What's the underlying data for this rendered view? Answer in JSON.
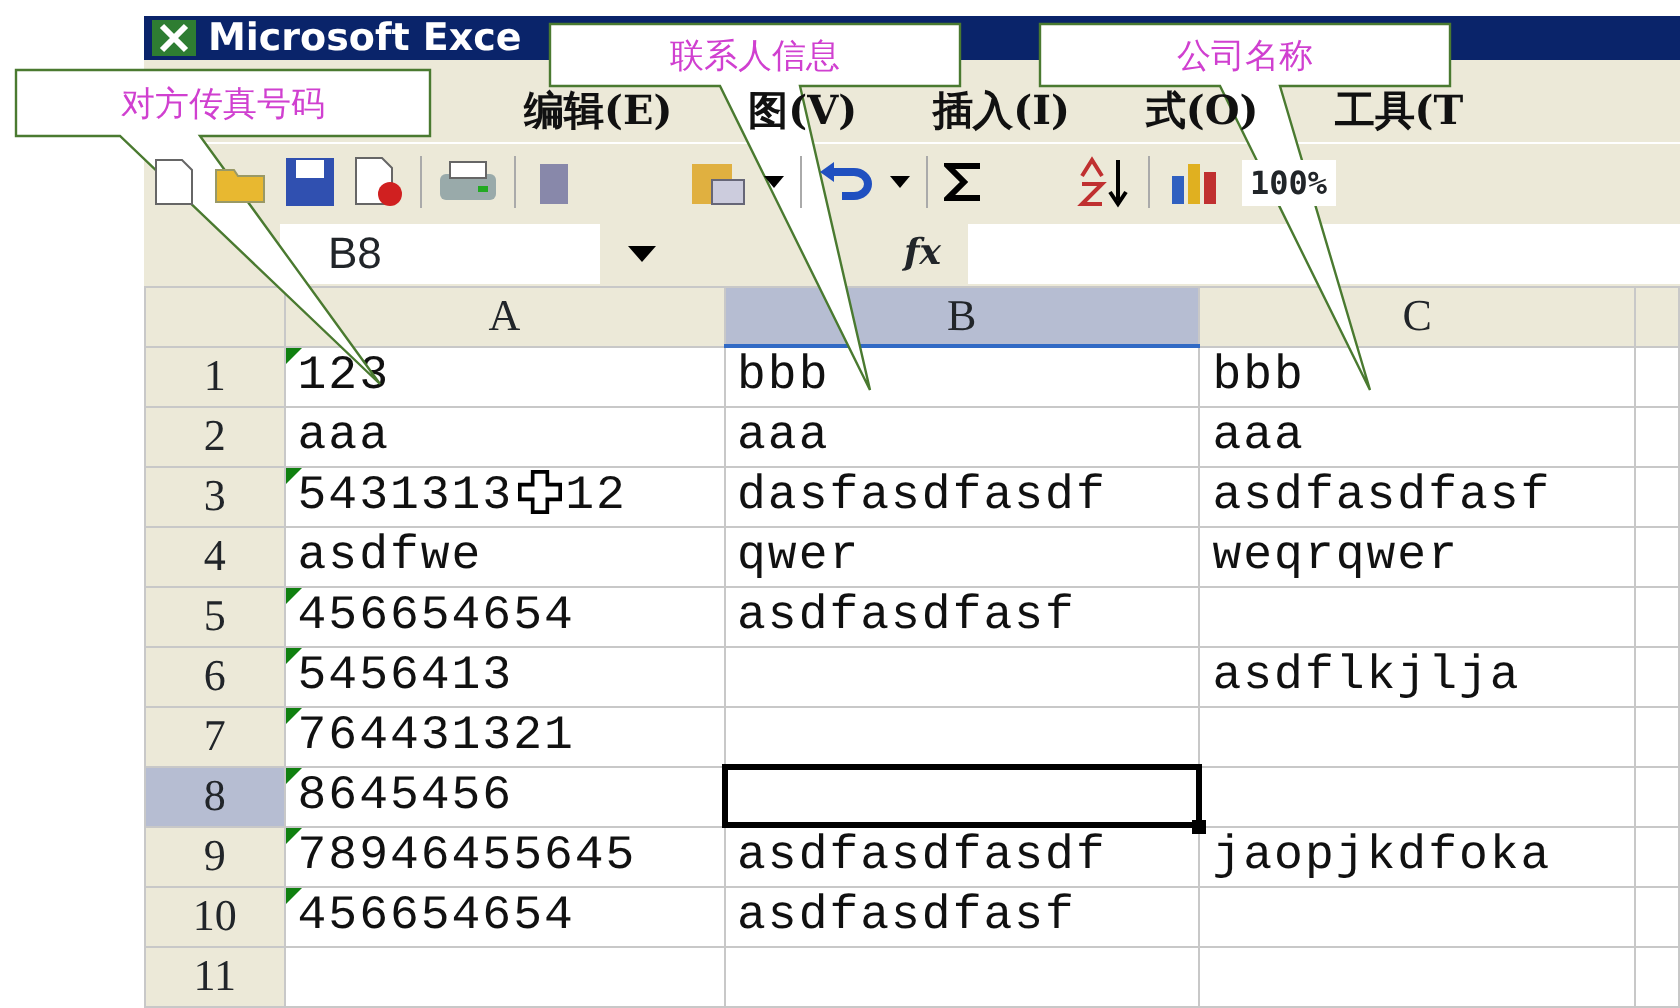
{
  "window": {
    "title": "Microsoft Exce"
  },
  "menu": [
    {
      "label": "编辑(E)"
    },
    {
      "label": "图(V)"
    },
    {
      "label": "插入(I)"
    },
    {
      "label": "式(O)"
    },
    {
      "label": "工具(T"
    }
  ],
  "toolbar": {
    "zoom": "100%"
  },
  "formula_bar": {
    "name_box": "B8",
    "fx": "fx"
  },
  "columns": [
    {
      "label": "A",
      "selected": false
    },
    {
      "label": "B",
      "selected": true
    },
    {
      "label": "C",
      "selected": false
    }
  ],
  "rows": [
    {
      "number": "1",
      "selected": false,
      "cells": [
        {
          "text": "123",
          "flag": true
        },
        {
          "text": "bbb"
        },
        {
          "text": "bbb"
        }
      ]
    },
    {
      "number": "2",
      "selected": false,
      "cells": [
        {
          "text": "aaa"
        },
        {
          "text": "aaa"
        },
        {
          "text": "aaa"
        }
      ]
    },
    {
      "number": "3",
      "selected": false,
      "cells": [
        {
          "text": "5431313",
          "after_cursor": "12",
          "flag": true
        },
        {
          "text": "dasfasdfasdf"
        },
        {
          "text": "asdfasdfasf"
        }
      ]
    },
    {
      "number": "4",
      "selected": false,
      "cells": [
        {
          "text": "asdfwe"
        },
        {
          "text": "qwer"
        },
        {
          "text": "weqrqwer"
        }
      ]
    },
    {
      "number": "5",
      "selected": false,
      "cells": [
        {
          "text": "456654654",
          "flag": true
        },
        {
          "text": "asdfasdfasf"
        },
        {}
      ]
    },
    {
      "number": "6",
      "selected": false,
      "cells": [
        {
          "text": "5456413",
          "flag": true
        },
        {},
        {
          "text": "asdflkjlja"
        }
      ]
    },
    {
      "number": "7",
      "selected": false,
      "cells": [
        {
          "text": "764431321",
          "flag": true
        },
        {},
        {}
      ]
    },
    {
      "number": "8",
      "selected": true,
      "cells": [
        {
          "text": "8645456",
          "flag": true
        },
        {
          "active": true
        },
        {}
      ]
    },
    {
      "number": "9",
      "selected": false,
      "cells": [
        {
          "text": "78946455645",
          "flag": true
        },
        {
          "text": "asdfasdfasdf"
        },
        {
          "text": "jaopjkdfoka"
        }
      ]
    },
    {
      "number": "10",
      "selected": false,
      "cells": [
        {
          "text": "456654654",
          "flag": true
        },
        {
          "text": "asdfasdfasf"
        },
        {}
      ]
    },
    {
      "number": "11",
      "selected": false,
      "cells": [
        {},
        {},
        {}
      ]
    }
  ],
  "callouts": [
    {
      "label": "对方传真号码"
    },
    {
      "label": "联系人信息"
    },
    {
      "label": "公司名称"
    }
  ]
}
